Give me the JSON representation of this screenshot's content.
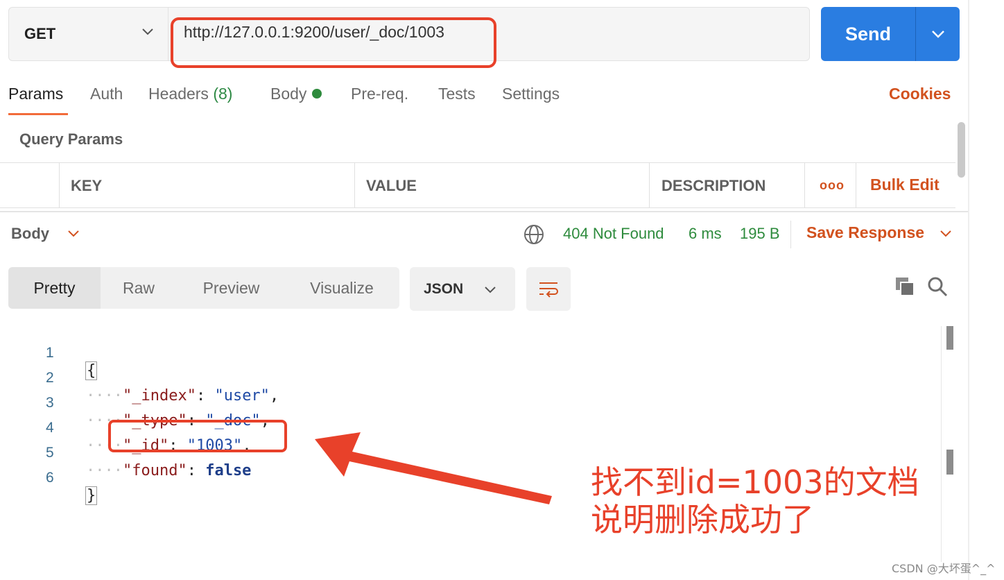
{
  "request": {
    "method": "GET",
    "url": "http://127.0.0.1:9200/user/_doc/1003",
    "send_label": "Send"
  },
  "tabs": {
    "params": "Params",
    "auth": "Auth",
    "headers": "Headers",
    "headers_count": "(8)",
    "body": "Body",
    "prereq": "Pre-req.",
    "tests": "Tests",
    "settings": "Settings",
    "cookies": "Cookies"
  },
  "query_params": {
    "title": "Query Params",
    "columns": [
      "KEY",
      "VALUE",
      "DESCRIPTION"
    ],
    "bulk_edit": "Bulk Edit",
    "more": "ooo"
  },
  "response": {
    "body_label": "Body",
    "status": "404 Not Found",
    "time": "6 ms",
    "size": "195 B",
    "save_label": "Save Response",
    "view_modes": [
      "Pretty",
      "Raw",
      "Preview",
      "Visualize"
    ],
    "active_view": "Pretty",
    "format": "JSON"
  },
  "code_lines": [
    {
      "num": "1",
      "open": "{"
    },
    {
      "num": "2",
      "key": "\"_index\"",
      "value": "\"user\"",
      "comma": ","
    },
    {
      "num": "3",
      "key": "\"_type\"",
      "value": "\"_doc\"",
      "comma": ","
    },
    {
      "num": "4",
      "key": "\"_id\"",
      "value": "\"1003\"",
      "comma": ","
    },
    {
      "num": "5",
      "key": "\"found\"",
      "value": "false",
      "comma": ""
    },
    {
      "num": "6",
      "close": "}"
    }
  ],
  "annotation": {
    "line1": "找不到id=1003的文档",
    "line2": "说明删除成功了"
  },
  "watermark": "CSDN @大坏蛋^_^",
  "colors": {
    "accent_orange": "#d2521f",
    "send_blue": "#2a7de1",
    "status_green": "#2e8b3d",
    "annotation_red": "#e8412a"
  }
}
